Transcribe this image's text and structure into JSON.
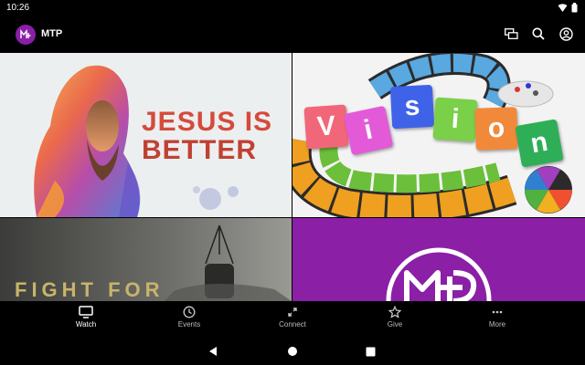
{
  "status": {
    "time": "10:26"
  },
  "app": {
    "title": "MTP"
  },
  "tiles": {
    "jesus": {
      "line1": "JESUS IS",
      "line2": "BETTER"
    },
    "vision": {
      "letters": [
        "V",
        "i",
        "s",
        "i",
        "o",
        "n"
      ]
    },
    "fight": {
      "text": "FIGHT FOR"
    }
  },
  "nav": [
    {
      "label": "Watch",
      "icon": "tv-icon",
      "active": true
    },
    {
      "label": "Events",
      "icon": "clock-icon",
      "active": false
    },
    {
      "label": "Connect",
      "icon": "connect-icon",
      "active": false
    },
    {
      "label": "Give",
      "icon": "star-icon",
      "active": false
    },
    {
      "label": "More",
      "icon": "more-icon",
      "active": false
    }
  ],
  "colors": {
    "brand": "#8b1fa6",
    "background": "#000000"
  }
}
